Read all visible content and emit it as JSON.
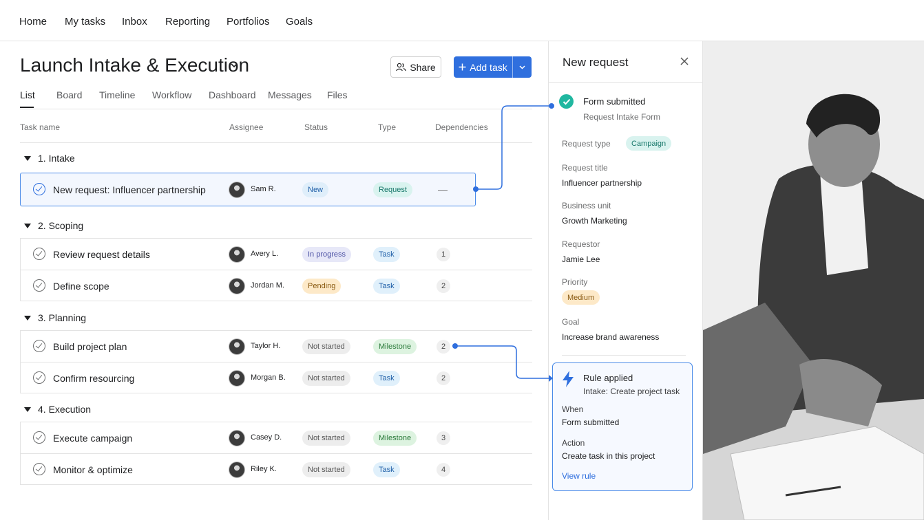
{
  "nav": {
    "items": [
      "Home",
      "My tasks",
      "Inbox",
      "Reporting",
      "Portfolios",
      "Goals"
    ]
  },
  "project": {
    "title": "Launch Intake & Execution",
    "share_label": "Share",
    "add_task_label": "Add task",
    "tabs": [
      "List",
      "Board",
      "Timeline",
      "Workflow",
      "Dashboard",
      "Messages",
      "Files"
    ],
    "active_tab": "List"
  },
  "columns": [
    "Task name",
    "Assignee",
    "Status",
    "Type",
    "Dependencies"
  ],
  "sections": [
    {
      "title": "1. Intake",
      "tasks": [
        {
          "name": "New request: Influencer partnership",
          "assignee": "Sam R.",
          "status": "New",
          "type": "Request",
          "dependencies": "—",
          "selected": true
        }
      ]
    },
    {
      "title": "2. Scoping",
      "tasks": [
        {
          "name": "Review request details",
          "assignee": "Avery L.",
          "status": "In progress",
          "type": "Task",
          "dependencies": "1"
        },
        {
          "name": "Define scope",
          "assignee": "Jordan M.",
          "status": "Pending",
          "type": "Task",
          "dependencies": "2"
        }
      ]
    },
    {
      "title": "3. Planning",
      "tasks": [
        {
          "name": "Build project plan",
          "assignee": "Taylor H.",
          "status": "Not started",
          "type": "Milestone",
          "dependencies": "2"
        },
        {
          "name": "Confirm resourcing",
          "assignee": "Morgan B.",
          "status": "Not started",
          "type": "Task",
          "dependencies": "2"
        }
      ]
    },
    {
      "title": "4. Execution",
      "tasks": [
        {
          "name": "Execute campaign",
          "assignee": "Casey D.",
          "status": "Not started",
          "type": "Milestone",
          "dependencies": "3"
        },
        {
          "name": "Monitor & optimize",
          "assignee": "Riley K.",
          "status": "Not started",
          "type": "Task",
          "dependencies": "4"
        }
      ]
    }
  ],
  "pill_colors": {
    "New": {
      "bg": "#dfeefa",
      "fg": "#1f5fa8"
    },
    "In progress": {
      "bg": "#e7e8f8",
      "fg": "#4a4fa3"
    },
    "Pending": {
      "bg": "#fde9c8",
      "fg": "#8a5a12"
    },
    "Not started": {
      "bg": "#ededed",
      "fg": "#555555"
    },
    "Request": {
      "bg": "#d9f3ef",
      "fg": "#18786b"
    },
    "Task": {
      "bg": "#e0f0fb",
      "fg": "#1f5fa8"
    },
    "Milestone": {
      "bg": "#ddf3e0",
      "fg": "#2a7a3a"
    }
  },
  "panel": {
    "title": "New request",
    "form_status": "Form submitted",
    "form_name": "Request Intake Form",
    "fields": {
      "request_type_label": "Request type",
      "request_type": "Campaign",
      "request_title_label": "Request title",
      "request_title": "Influencer partnership",
      "business_unit_label": "Business unit",
      "business_unit": "Growth Marketing",
      "requestor_label": "Requestor",
      "requestor": "Jamie Lee",
      "priority_label": "Priority",
      "priority": "Medium",
      "goal_label": "Goal",
      "goal": "Increase brand awareness"
    },
    "rule": {
      "title": "Rule applied",
      "name": "Intake: Create project task",
      "when_label": "When",
      "when": "Form submitted",
      "action_label": "Action",
      "action": "Create task in this project",
      "link": "View rule"
    }
  },
  "accent": "#2f6fde",
  "success_color": "#20b7a0"
}
